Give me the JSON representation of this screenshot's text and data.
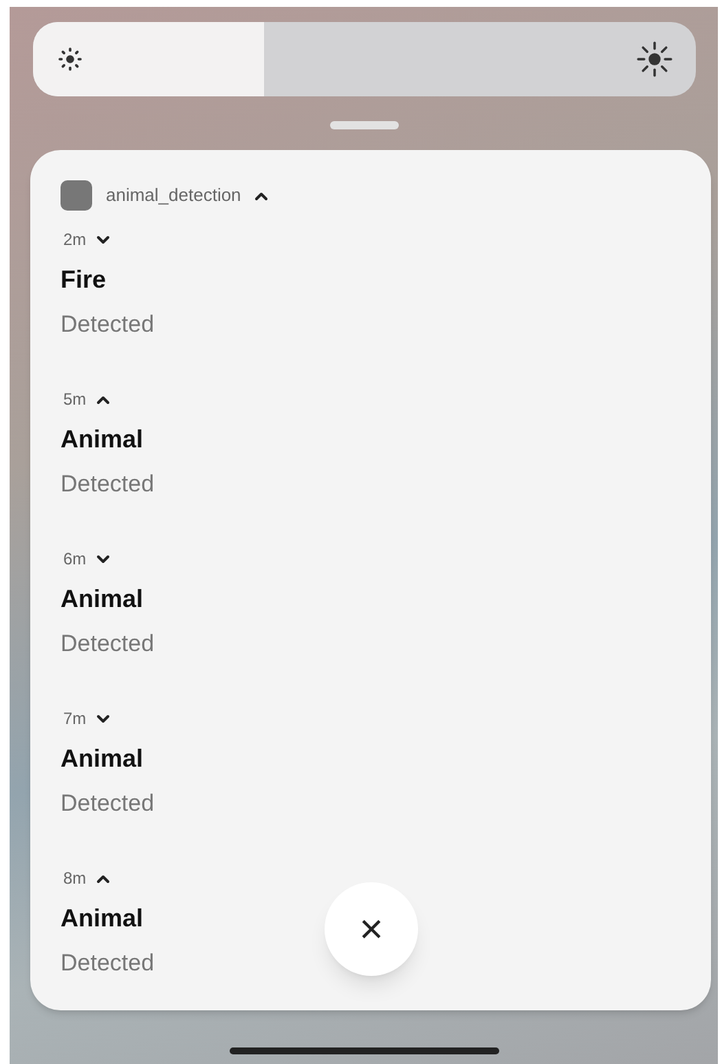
{
  "brightness": {
    "level": 0.35
  },
  "group": {
    "app_name": "animal_detection",
    "expanded": true,
    "notifications": [
      {
        "time": "2m",
        "expanded": false,
        "title": "Fire",
        "body": "Detected"
      },
      {
        "time": "5m",
        "expanded": true,
        "title": "Animal",
        "body": "Detected"
      },
      {
        "time": "6m",
        "expanded": false,
        "title": "Animal",
        "body": "Detected"
      },
      {
        "time": "7m",
        "expanded": false,
        "title": "Animal",
        "body": "Detected"
      },
      {
        "time": "8m",
        "expanded": true,
        "title": "Animal",
        "body": "Detected"
      }
    ]
  },
  "close_button": {
    "label": "×"
  }
}
